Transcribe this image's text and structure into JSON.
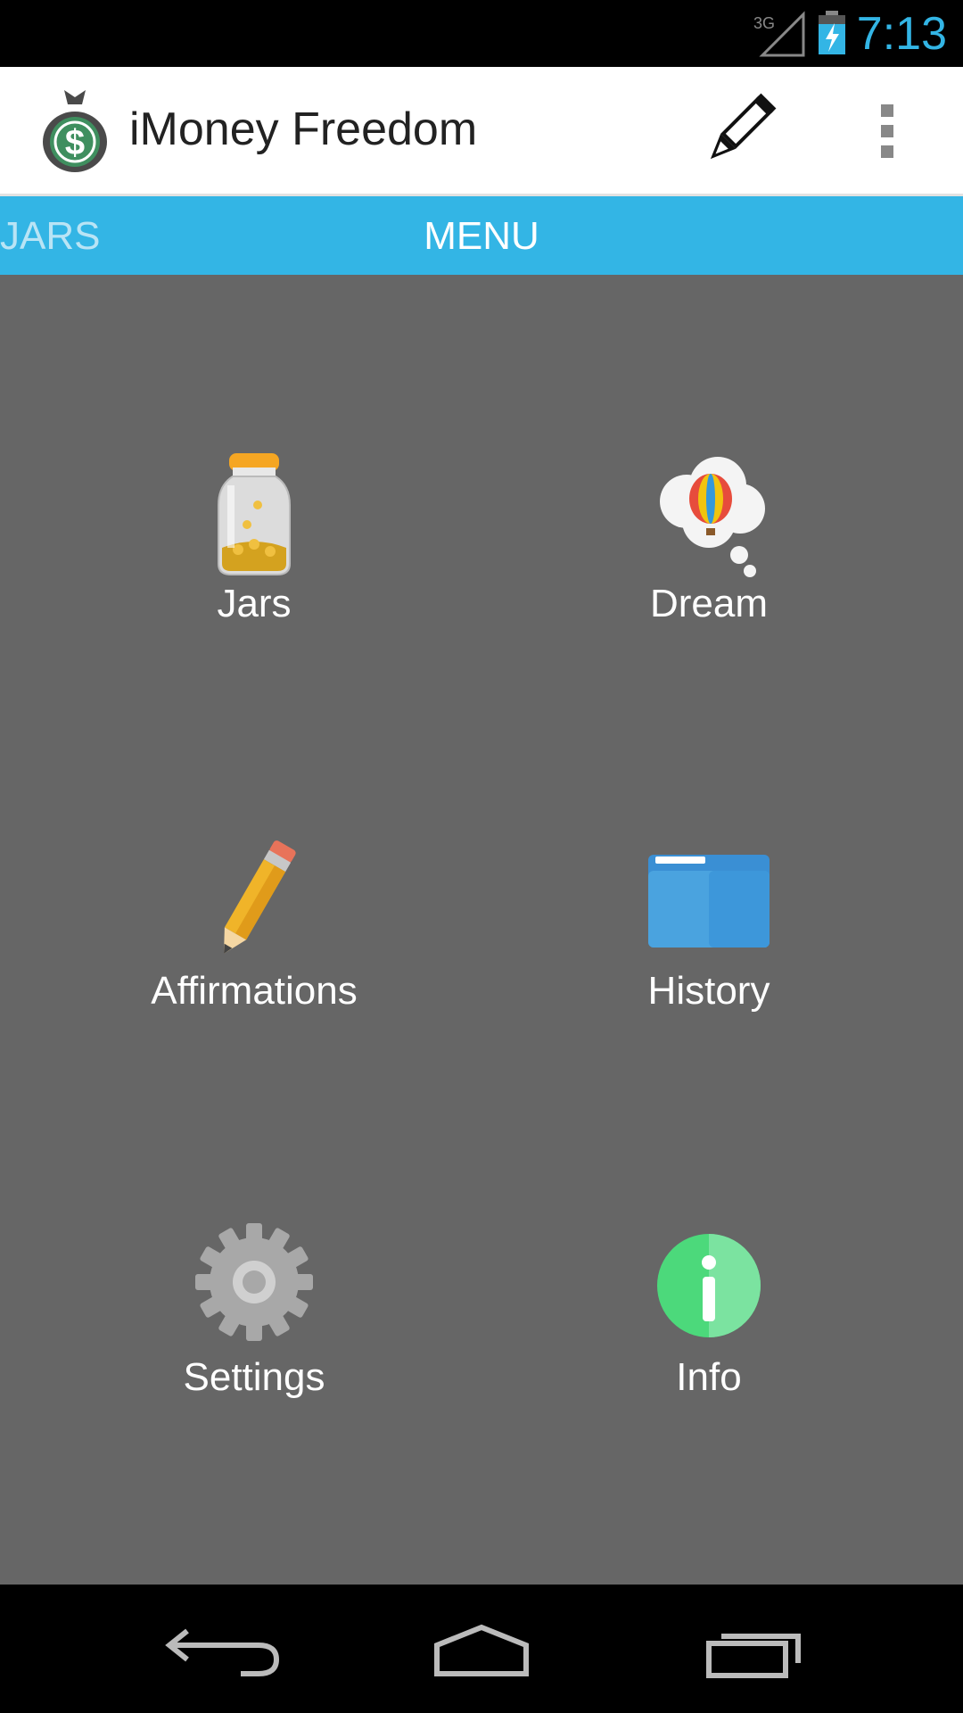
{
  "status_bar": {
    "network": "3G",
    "time": "7:13"
  },
  "action_bar": {
    "title": "iMoney Freedom"
  },
  "tabs": {
    "previous": "JARS",
    "current": "MENU"
  },
  "menu": {
    "items": [
      {
        "label": "Jars",
        "icon": "jar-icon"
      },
      {
        "label": "Dream",
        "icon": "dream-balloon-icon"
      },
      {
        "label": "Affirmations",
        "icon": "pencil-icon"
      },
      {
        "label": "History",
        "icon": "folder-icon"
      },
      {
        "label": "Settings",
        "icon": "gear-icon"
      },
      {
        "label": "Info",
        "icon": "info-icon"
      }
    ]
  },
  "colors": {
    "accent": "#33b5e5",
    "background": "#666666"
  }
}
